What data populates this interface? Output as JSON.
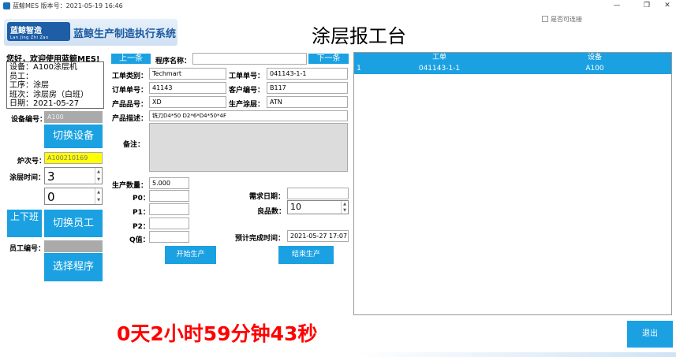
{
  "window": {
    "title": "蓝鲸MES 版本号：2021-05-19 16:46",
    "minimize_glyph": "—",
    "maximize_glyph": "❐",
    "close_glyph": "✕"
  },
  "header": {
    "logo_mark": "蓝鲸智造",
    "logo_mark_sub": "Lan Jing Zhi Zao",
    "logo_text": "蓝鲸生产制造执行系统",
    "page_title": "涂层报工台",
    "connect_checkbox_label": "是否可连接"
  },
  "left": {
    "welcome": "您好，欢迎使用蓝鲸MES!",
    "info_lines": [
      "设备：A100涂层机",
      "员工：",
      "工序：涂层",
      "班次：涂层房（白班）",
      "日期：2021-05-27"
    ],
    "device_no_label": "设备编号：",
    "device_no_value": "A100",
    "switch_device_button": "切换设备",
    "furnace_label": "炉次号：",
    "furnace_value": "A100210169",
    "coating_time_label": "涂层时间：",
    "coating_time_value1": "3",
    "coating_time_value2": "0",
    "shift_button": "上下班",
    "switch_employee_button": "切换员工",
    "employee_no_label": "员工编号：",
    "employee_no_value": "",
    "select_program_button": "选择程序"
  },
  "form": {
    "prev_button": "上一条",
    "next_button": "下一条",
    "program_name_label": "程序名称：",
    "program_name_value": "",
    "order_type_label": "工单类别：",
    "order_type_value": "Techmart",
    "order_no_label": "工单单号：",
    "order_no_value": "041143-1-1",
    "sales_order_label": "订单单号：",
    "sales_order_value": "41143",
    "customer_no_label": "客户编号：",
    "customer_no_value": "B117",
    "product_no_label": "产品品号：",
    "product_no_value": "XD",
    "coating_label": "生产涂层：",
    "coating_value": "ATN",
    "product_desc_label": "产品描述：",
    "product_desc_value": "铣刀D4*50   D2*6*D4*50*4F",
    "remark_label": "备注：",
    "remark_value": "",
    "qty_label": "生产数量：",
    "qty_value": "5.000",
    "p0_label": "P0：",
    "p0_value": "",
    "p1_label": "P1：",
    "p1_value": "",
    "p2_label": "P2：",
    "p2_value": "",
    "q_label": "Q值：",
    "q_value": "",
    "demand_date_label": "需求日期：",
    "demand_date_value": "",
    "good_qty_label": "良品数：",
    "good_qty_value": "10",
    "expected_finish_label": "预计完成时间：",
    "expected_finish_value": "2021-05-27 17:07:",
    "start_button": "开始生产",
    "end_button": "结束生产"
  },
  "grid": {
    "columns": [
      "工单",
      "设备"
    ],
    "rows": [
      {
        "index": "1",
        "order": "041143-1-1",
        "device": "A100"
      }
    ]
  },
  "timer": "0天2小时59分钟43秒",
  "exit_button": "退出",
  "colors": {
    "accent": "#1ba1e2",
    "timer": "#ff0000",
    "furnace_bg": "#ffff00"
  }
}
